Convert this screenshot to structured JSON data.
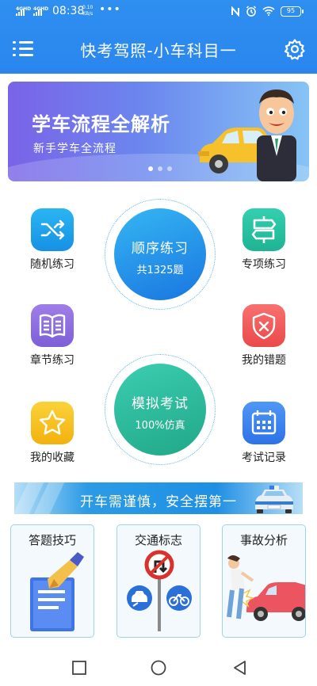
{
  "status": {
    "net1": "4G",
    "net1_sub": "HD",
    "net2": "4G",
    "net2_sub": "HD",
    "time": "08:38",
    "speed_value": "0.10",
    "speed_unit": "KB/s",
    "more": "•••",
    "battery": "95"
  },
  "header": {
    "title": "快考驾照-小车科目一",
    "icons": [
      "menu-icon",
      "gear-icon"
    ]
  },
  "banner": {
    "headline": "学车流程全解析",
    "subline": "新手学车全流程",
    "active_dot": 0,
    "dots": 3
  },
  "grid": {
    "random": "随机练习",
    "special": "专项练习",
    "chapter": "章节练习",
    "mistakes": "我的错题",
    "favorites": "我的收藏",
    "records": "考试记录"
  },
  "sequence": {
    "label": "顺序练习",
    "count": "共1325题"
  },
  "mock": {
    "label": "模拟考试",
    "note": "100%仿真"
  },
  "strip": {
    "text": "开车需谨慎，安全摆第一"
  },
  "cards": {
    "tips": "答题技巧",
    "signs": "交通标志",
    "accidents": "事故分析"
  },
  "colors": {
    "header": "#2f8ff0",
    "random": "#1aa3ee",
    "special": "#26c2a3",
    "chapter": "#8e6fe0",
    "mistakes": "#f25b5b",
    "favorites": "#f7c21e",
    "records": "#3d86f0"
  }
}
